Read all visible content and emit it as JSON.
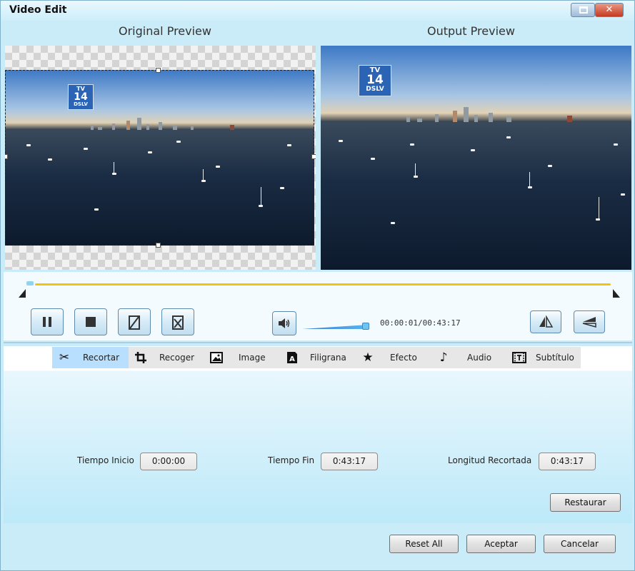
{
  "window": {
    "title": "Video Edit",
    "close_glyph": "✕"
  },
  "preview": {
    "original_label": "Original Preview",
    "output_label": "Output Preview",
    "logo_top": "TV",
    "logo_num": "14",
    "logo_bottom": "DSLV"
  },
  "player": {
    "timecode": "00:00:01/00:43:17",
    "progress_fraction": 0.0,
    "volume_fraction": 1.0,
    "icons": [
      "pause-icon",
      "stop-icon",
      "snapshot-icon",
      "snapshot-folder-icon",
      "volume-icon",
      "flip-horizontal-icon",
      "flip-vertical-icon"
    ]
  },
  "tabs": [
    {
      "label": "Recortar",
      "icon": "scissors-icon",
      "active": true
    },
    {
      "label": "Recoger",
      "icon": "crop-icon",
      "active": false
    },
    {
      "label": "Image",
      "icon": "image-icon",
      "active": false
    },
    {
      "label": "Filigrana",
      "icon": "watermark-icon",
      "active": false
    },
    {
      "label": "Efecto",
      "icon": "star-icon",
      "active": false
    },
    {
      "label": "Audio",
      "icon": "music-note-icon",
      "active": false
    },
    {
      "label": "Subtítulo",
      "icon": "subtitle-icon",
      "active": false
    }
  ],
  "trim": {
    "start_label": "Tiempo Inicio",
    "start_value": "0:00:00",
    "end_label": "Tiempo Fin",
    "end_value": "0:43:17",
    "length_label": "Longitud Recortada",
    "length_value": "0:43:17",
    "restore_label": "Restaurar"
  },
  "footer": {
    "reset_all_label": "Reset All",
    "accept_label": "Aceptar",
    "cancel_label": "Cancelar"
  }
}
